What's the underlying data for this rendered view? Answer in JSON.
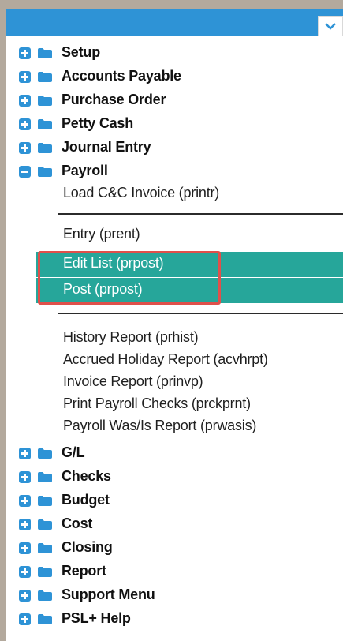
{
  "menu": {
    "top_groups": [
      {
        "label": "Setup"
      },
      {
        "label": "Accounts Payable"
      },
      {
        "label": "Purchase Order"
      },
      {
        "label": "Petty Cash"
      },
      {
        "label": "Journal Entry"
      }
    ],
    "expanded_group": {
      "label": "Payroll",
      "items_a": [
        "Load C&C Invoice (printr)"
      ],
      "items_b": [
        "Entry (prent)"
      ],
      "highlighted": [
        "Edit List (prpost)",
        "Post (prpost)"
      ],
      "items_c": [
        "History Report (prhist)",
        "Accrued Holiday Report (acvhrpt)",
        "Invoice Report (prinvp)",
        "Print Payroll Checks (prckprnt)",
        "Payroll Was/Is Report (prwasis)"
      ]
    },
    "bottom_groups": [
      {
        "label": "G/L"
      },
      {
        "label": "Checks"
      },
      {
        "label": "Budget"
      },
      {
        "label": "Cost"
      },
      {
        "label": "Closing"
      },
      {
        "label": "Report"
      },
      {
        "label": "Support Menu"
      },
      {
        "label": "PSL+ Help"
      }
    ]
  },
  "colors": {
    "accent": "#2e93d6",
    "highlight": "#26a69a",
    "callout": "#e0504b"
  },
  "icons": {
    "expand": "plus-square-icon",
    "collapse": "minus-square-icon",
    "folder": "folder-icon",
    "dropdown": "chevron-down-icon"
  }
}
